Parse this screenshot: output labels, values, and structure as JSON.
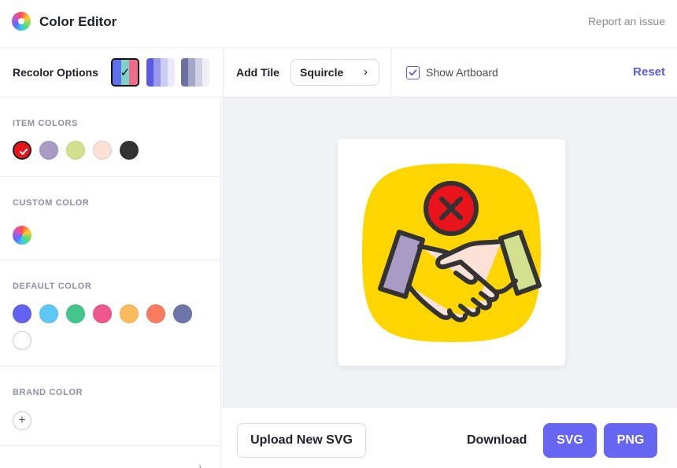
{
  "header": {
    "app_title": "Color Editor",
    "report_link": "Report an issue",
    "logo_icon": "color-wheel-icon"
  },
  "toolbar": {
    "recolor_label": "Recolor Options",
    "recolor_options": [
      {
        "name": "multicolor",
        "colors": [
          "#5e6ff0",
          "#7dd3c7",
          "#f06b8a"
        ],
        "selected": true
      },
      {
        "name": "blue-shades",
        "colors": [
          "#5b5bdf",
          "#9999f0",
          "#ccccf8",
          "#eaeafc"
        ],
        "selected": false
      },
      {
        "name": "slate-shades",
        "colors": [
          "#6b70a0",
          "#a3a6c6",
          "#d0d2e4",
          "#eeeff6"
        ],
        "selected": false
      }
    ],
    "add_tile_label": "Add Tile",
    "tile_value": "Squircle",
    "show_artboard_label": "Show Artboard",
    "show_artboard_checked": true,
    "reset_label": "Reset"
  },
  "sidebar": {
    "item_colors": {
      "title": "ITEM COLORS",
      "swatches": [
        "#e8131b",
        "#a99bc4",
        "#d3e18e",
        "#fbe1d6",
        "#333333"
      ],
      "selected_index": 0
    },
    "custom_color": {
      "title": "CUSTOM COLOR"
    },
    "default_color": {
      "title": "DEFAULT COLOR",
      "swatches": [
        "#6262f0",
        "#5dc8f5",
        "#43c58c",
        "#f0578e",
        "#fbbb5c",
        "#f77b5c",
        "#6c74a8",
        "#ffffff"
      ]
    },
    "brand_color": {
      "title": "BRAND COLOR",
      "add_label": "+"
    }
  },
  "canvas": {
    "artboard_visible": true,
    "icon": "handshake-declined-icon",
    "tile_shape": "squircle",
    "colors": {
      "tile": "#ffd500",
      "cross_circle": "#e8131b",
      "sleeve_left": "#a99bc4",
      "sleeve_right": "#d3e18e",
      "hands": "#fbe1d6",
      "outline": "#333333"
    }
  },
  "footer": {
    "upload_label": "Upload New SVG",
    "download_label": "Download",
    "svg_label": "SVG",
    "png_label": "PNG"
  },
  "theme": {
    "accent": "#6262f0",
    "accent_text": "#5b5bdf"
  }
}
